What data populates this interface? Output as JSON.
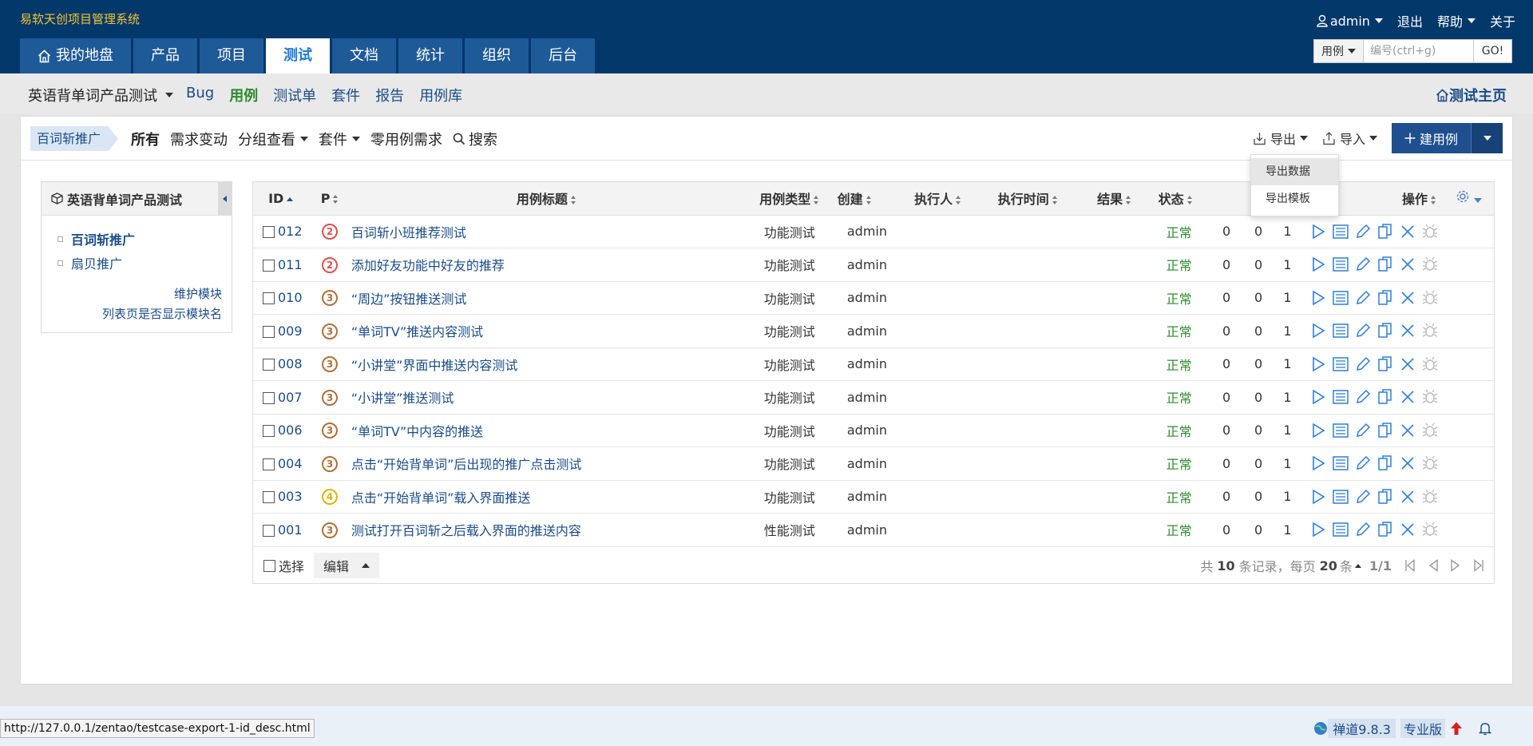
{
  "app": {
    "title": "易软天创项目管理系统"
  },
  "user_nav": {
    "user": "admin",
    "logout": "退出",
    "help": "帮助",
    "about": "关于"
  },
  "main_nav": [
    {
      "label": "我的地盘",
      "active": false,
      "home": true
    },
    {
      "label": "产品",
      "active": false
    },
    {
      "label": "项目",
      "active": false
    },
    {
      "label": "测试",
      "active": true
    },
    {
      "label": "文档",
      "active": false
    },
    {
      "label": "统计",
      "active": false
    },
    {
      "label": "组织",
      "active": false
    },
    {
      "label": "后台",
      "active": false
    }
  ],
  "quick_search": {
    "type": "用例",
    "placeholder": "编号(ctrl+g)",
    "go": "GO!"
  },
  "subnav": {
    "product": "英语背单词产品测试",
    "items": [
      {
        "label": "Bug",
        "active": false
      },
      {
        "label": "用例",
        "active": true
      },
      {
        "label": "测试单",
        "active": false
      },
      {
        "label": "套件",
        "active": false
      },
      {
        "label": "报告",
        "active": false
      },
      {
        "label": "用例库",
        "active": false
      }
    ],
    "home": "测试主页"
  },
  "featurebar": {
    "module": "百词斩推广",
    "all": "所有",
    "changed": "需求变动",
    "group": "分组查看",
    "suite": "套件",
    "zero": "零用例需求",
    "search": "搜索",
    "export": "导出",
    "import": "导入",
    "create": "建用例"
  },
  "export_menu": [
    "导出数据",
    "导出模板"
  ],
  "side": {
    "title": "英语背单词产品测试",
    "modules": [
      {
        "label": "百词斩推广",
        "active": true
      },
      {
        "label": "扇贝推广",
        "active": false
      }
    ],
    "manage": "维护模块",
    "show_module": "列表页是否显示模块名"
  },
  "table": {
    "headers": {
      "id": "ID",
      "pri": "P",
      "title": "用例标题",
      "type": "用例类型",
      "creator": "创建",
      "executor": "执行人",
      "exec_time": "执行时间",
      "result": "结果",
      "status": "状态",
      "actions": "操作"
    },
    "rows": [
      {
        "id": "012",
        "pri": "2",
        "title": "百词斩小班推荐测试",
        "type": "功能测试",
        "creator": "admin",
        "status": "正常",
        "bugs": "0",
        "results": "0",
        "steps": "1"
      },
      {
        "id": "011",
        "pri": "2",
        "title": "添加好友功能中好友的推荐",
        "type": "功能测试",
        "creator": "admin",
        "status": "正常",
        "bugs": "0",
        "results": "0",
        "steps": "1"
      },
      {
        "id": "010",
        "pri": "3",
        "title": "“周边”按钮推送测试",
        "type": "功能测试",
        "creator": "admin",
        "status": "正常",
        "bugs": "0",
        "results": "0",
        "steps": "1"
      },
      {
        "id": "009",
        "pri": "3",
        "title": "“单词TV”推送内容测试",
        "type": "功能测试",
        "creator": "admin",
        "status": "正常",
        "bugs": "0",
        "results": "0",
        "steps": "1"
      },
      {
        "id": "008",
        "pri": "3",
        "title": "“小讲堂”界面中推送内容测试",
        "type": "功能测试",
        "creator": "admin",
        "status": "正常",
        "bugs": "0",
        "results": "0",
        "steps": "1"
      },
      {
        "id": "007",
        "pri": "3",
        "title": "“小讲堂”推送测试",
        "type": "功能测试",
        "creator": "admin",
        "status": "正常",
        "bugs": "0",
        "results": "0",
        "steps": "1"
      },
      {
        "id": "006",
        "pri": "3",
        "title": "“单词TV”中内容的推送",
        "type": "功能测试",
        "creator": "admin",
        "status": "正常",
        "bugs": "0",
        "results": "0",
        "steps": "1"
      },
      {
        "id": "004",
        "pri": "3",
        "title": "点击“开始背单词”后出现的推广点击测试",
        "type": "功能测试",
        "creator": "admin",
        "status": "正常",
        "bugs": "0",
        "results": "0",
        "steps": "1"
      },
      {
        "id": "003",
        "pri": "4",
        "title": "点击“开始背单词”载入界面推送",
        "type": "功能测试",
        "creator": "admin",
        "status": "正常",
        "bugs": "0",
        "results": "0",
        "steps": "1"
      },
      {
        "id": "001",
        "pri": "3",
        "title": "测试打开百词斩之后载入界面的推送内容",
        "type": "性能测试",
        "creator": "admin",
        "status": "正常",
        "bugs": "0",
        "results": "0",
        "steps": "1"
      }
    ]
  },
  "footer": {
    "select_all": "选择",
    "edit": "编辑",
    "total_pre": "共",
    "total": "10",
    "total_post": "条记录，每页",
    "per_page": "20",
    "per_page_unit": "条",
    "page": "1/1"
  },
  "statusbar": {
    "url": "http://127.0.0.1/zentao/testcase-export-1-id_desc.html",
    "version": "禅道9.8.3",
    "edition": "专业版"
  },
  "colors": {
    "header_bg": "#03386b",
    "accent": "#1f4f8e",
    "pri2": "#d9534f",
    "pri3": "#b0703a",
    "pri4": "#e0b400",
    "status_ok": "#2e8b2e"
  }
}
